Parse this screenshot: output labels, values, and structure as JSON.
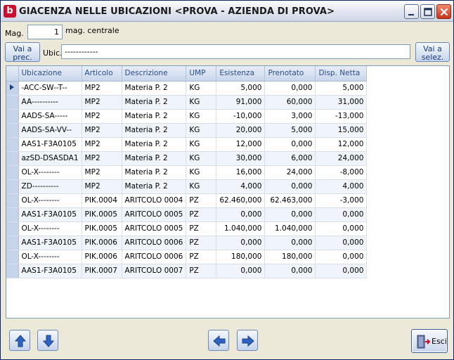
{
  "window": {
    "title": "GIACENZA NELLE UBICAZIONI <PROVA - AZIENDA DI PROVA>",
    "app_icon_letter": "b"
  },
  "filters": {
    "mag_label": "Mag.",
    "mag_value": "1",
    "mag_description": "mag. centrale",
    "vai_prec_label": "Vai a prec.",
    "ubic_label": "Ubic.",
    "ubic_value": "------------",
    "vai_selez_label": "Vai a selez."
  },
  "grid": {
    "columns": [
      "Ubicazione",
      "Articolo",
      "Descrizione",
      "UMP",
      "Esistenza",
      "Prenotato",
      "Disp. Netta"
    ],
    "rows": [
      [
        "-ACC-SW--T--",
        "MP2",
        "Materia P. 2",
        "KG",
        "5,000",
        "0,000",
        "5,000"
      ],
      [
        "AA----------",
        "MP2",
        "Materia P. 2",
        "KG",
        "91,000",
        "60,000",
        "31,000"
      ],
      [
        "AADS-SA-----",
        "MP2",
        "Materia P. 2",
        "KG",
        "-10,000",
        "3,000",
        "-13,000"
      ],
      [
        "AADS-SA-VV--",
        "MP2",
        "Materia P. 2",
        "KG",
        "20,000",
        "5,000",
        "15,000"
      ],
      [
        "AAS1-F3A0105",
        "MP2",
        "Materia P. 2",
        "KG",
        "12,000",
        "0,000",
        "12,000"
      ],
      [
        "azSD-DSASDA1",
        "MP2",
        "Materia P. 2",
        "KG",
        "30,000",
        "6,000",
        "24,000"
      ],
      [
        "OL-X--------",
        "MP2",
        "Materia P. 2",
        "KG",
        "16,000",
        "24,000",
        "-8,000"
      ],
      [
        "ZD----------",
        "MP2",
        "Materia P. 2",
        "KG",
        "4,000",
        "0,000",
        "4,000"
      ],
      [
        "OL-X--------",
        "PIK.0004",
        "ARITCOLO 0004",
        "PZ",
        "62.460,000",
        "62.463,000",
        "-3,000"
      ],
      [
        "AAS1-F3A0105",
        "PIK.0005",
        "ARITCOLO 0005",
        "PZ",
        "0,000",
        "0,000",
        "0,000"
      ],
      [
        "OL-X--------",
        "PIK.0005",
        "ARITCOLO 0005",
        "PZ",
        "1.040,000",
        "1.040,000",
        "0,000"
      ],
      [
        "AAS1-F3A0105",
        "PIK.0006",
        "ARITCOLO 0006",
        "PZ",
        "0,000",
        "0,000",
        "0,000"
      ],
      [
        "OL-X--------",
        "PIK.0006",
        "ARITCOLO 0006",
        "PZ",
        "180,000",
        "180,000",
        "0,000"
      ],
      [
        "AAS1-F3A0105",
        "PIK.0007",
        "ARITCOLO 0007",
        "PZ",
        "0,000",
        "0,000",
        "0,000"
      ]
    ],
    "selected_row": 0
  },
  "buttons": {
    "esci_label": "Esci"
  },
  "icons": {
    "up": "arrow-up-icon",
    "down": "arrow-down-icon",
    "left": "arrow-left-icon",
    "right": "arrow-right-icon",
    "exit": "exit-door-icon"
  },
  "colors": {
    "accent": "#2a4e8c",
    "close": "#c9361a",
    "brand": "#c8102e"
  }
}
